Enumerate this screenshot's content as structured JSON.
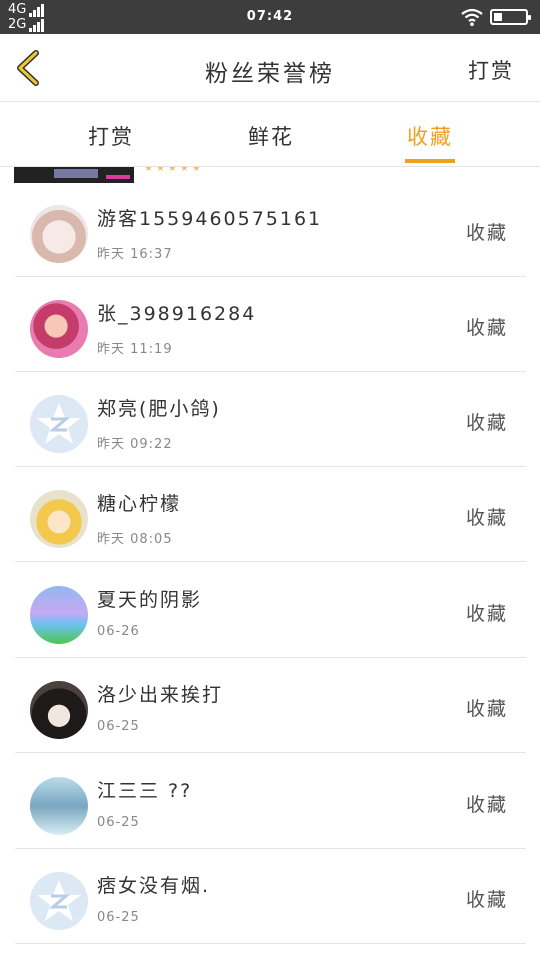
{
  "status_bar": {
    "network_top": "4G",
    "network_bottom": "2G",
    "time": "07:42"
  },
  "header": {
    "title": "粉丝荣誉榜",
    "right_link": "打赏"
  },
  "tabs": [
    {
      "label": "打赏"
    },
    {
      "label": "鲜花"
    },
    {
      "label": "收藏",
      "active": true
    }
  ],
  "accent_color": "#f0a020",
  "list": [
    {
      "name": "游客1559460575161",
      "time": "昨天 16:37",
      "action": "收藏",
      "avatar": "girl-avatar"
    },
    {
      "name": "张_398916284",
      "time": "昨天 11:19",
      "action": "收藏",
      "avatar": "girl-avatar"
    },
    {
      "name": "郑亮(肥小鸽)",
      "time": "昨天 09:22",
      "action": "收藏",
      "avatar": "default-qq-avatar"
    },
    {
      "name": "糖心柠檬",
      "time": "昨天 08:05",
      "action": "收藏",
      "avatar": "anime-avatar"
    },
    {
      "name": "夏天的阴影",
      "time": "06-26",
      "action": "收藏",
      "avatar": "castle-avatar"
    },
    {
      "name": "洛少出来挨打",
      "time": "06-25",
      "action": "收藏",
      "avatar": "anime-avatar"
    },
    {
      "name": "江三三 ??",
      "time": "06-25",
      "action": "收藏",
      "avatar": "photo-avatar"
    },
    {
      "name": "痞女没有烟.",
      "time": "06-25",
      "action": "收藏",
      "avatar": "default-qq-avatar"
    }
  ]
}
